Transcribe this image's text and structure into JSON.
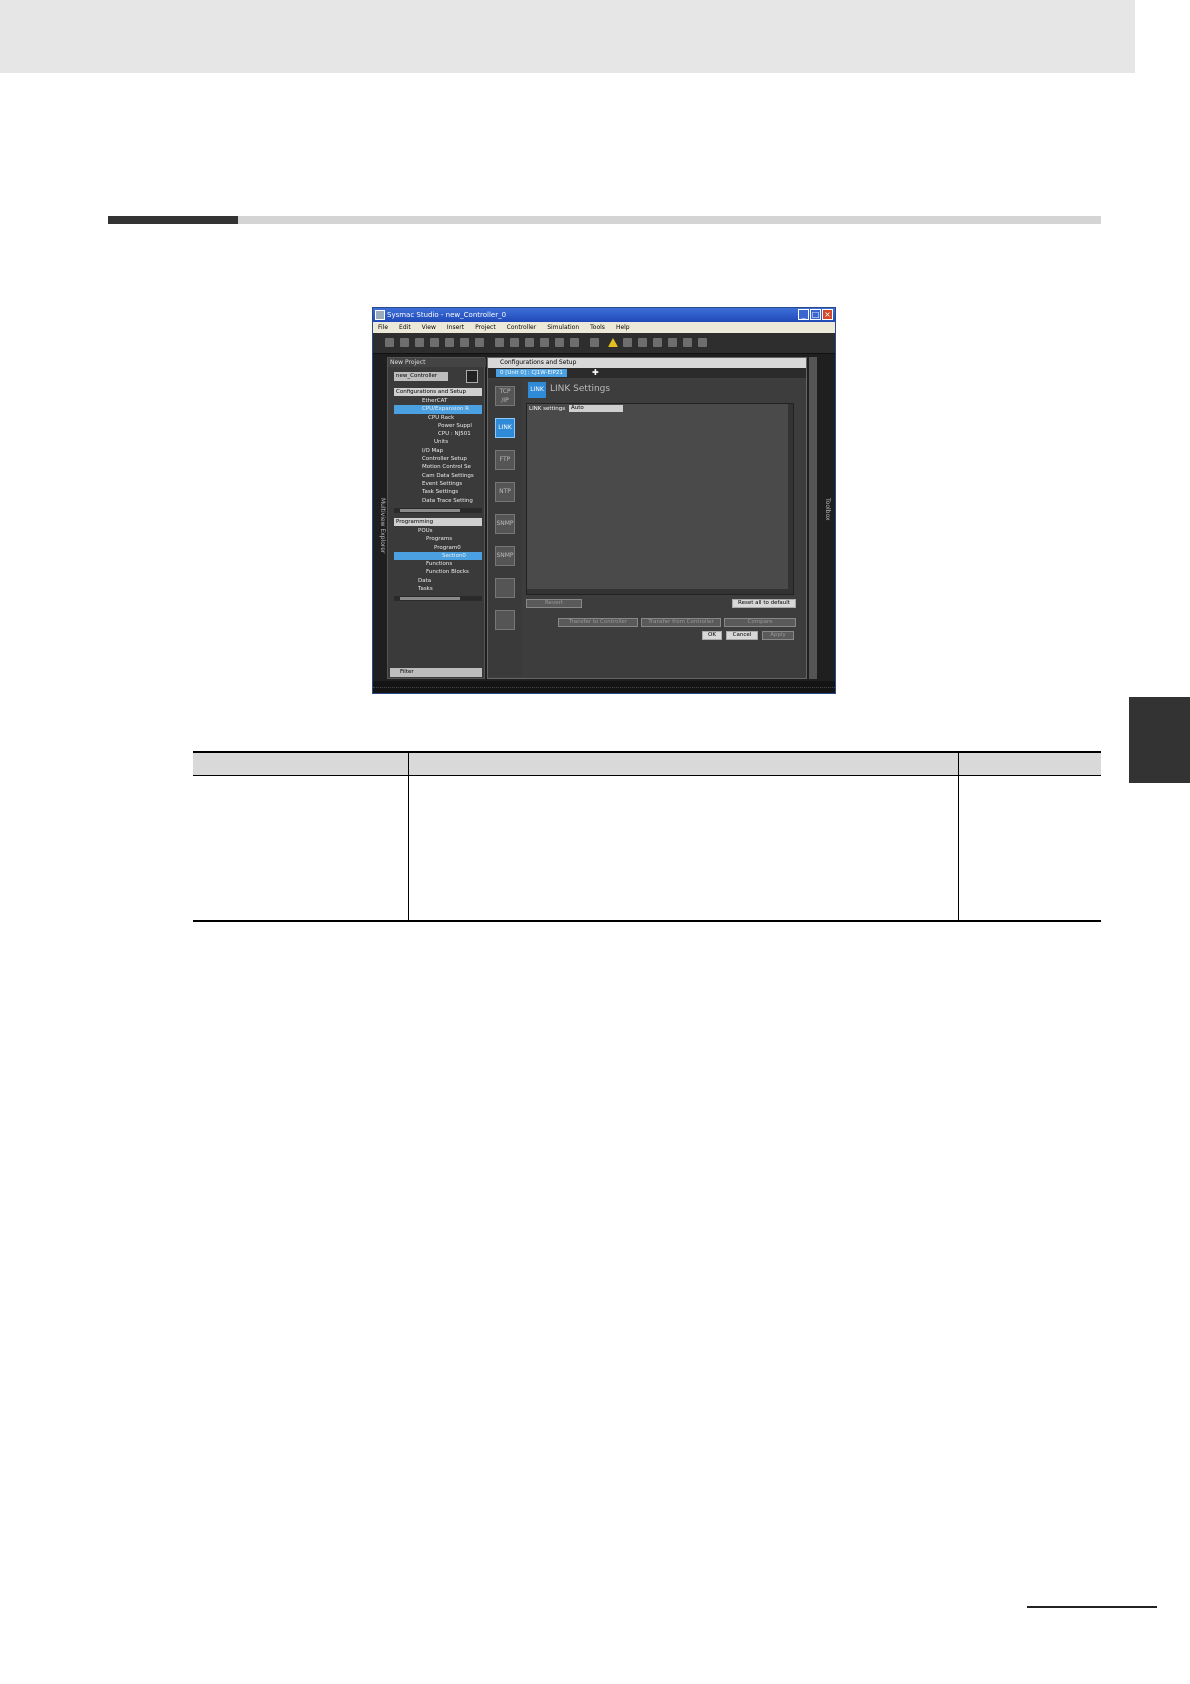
{
  "screenshot": {
    "title": "Sysmac Studio - new_Controller_0",
    "window_buttons": [
      "_",
      "□",
      "×"
    ],
    "menu": [
      "File",
      "Edit",
      "View",
      "Insert",
      "Project",
      "Controller",
      "Simulation",
      "Tools",
      "Help"
    ],
    "explorer": {
      "side_label": "Multiview Explorer",
      "header": "New Project",
      "controller": "new_Controller",
      "config_group": "Configurations and Setup",
      "config_items": [
        "EtherCAT",
        "CPU/Expansion R",
        "CPU Rack",
        "Power Suppl",
        "CPU : NJ501",
        "Units",
        "I/O Map",
        "Controller Setup",
        "Motion Control Se",
        "Cam Data Settings",
        "Event Settings",
        "Task Settings",
        "Data Trace Setting"
      ],
      "prog_group": "Programming",
      "prog_items": [
        "POUs",
        "Programs",
        "Program0",
        "Section0",
        "Functions",
        "Function Blocks",
        "Data",
        "Tasks"
      ],
      "filter": "Filter"
    },
    "main": {
      "panel_title": "Configurations and Setup",
      "tab": "0 [Unit 0] : CJ1W-EIP21",
      "side_icons": [
        "TCP /IP",
        "LINK",
        "FTP",
        "NTP",
        "SNMP",
        "SNMP",
        "",
        ""
      ],
      "heading_icon": "LINK",
      "heading": "LINK Settings",
      "setting_label": "LINK settings",
      "setting_value": "Auto",
      "buttons": {
        "revert": "Revert",
        "reset": "Reset all to default",
        "transfer_to": "Transfer to Controller",
        "transfer_from": "Transfer from Controller",
        "compare": "Compare",
        "ok": "OK",
        "cancel": "Cancel",
        "apply": "Apply"
      },
      "right_label": "Toolbox"
    }
  }
}
